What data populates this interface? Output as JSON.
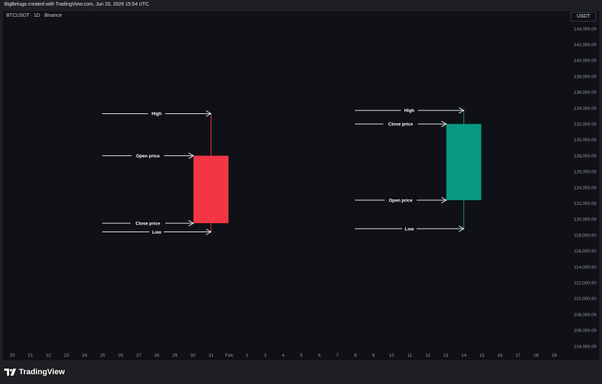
{
  "header": {
    "attribution": "BigBeluga created with TradingView.com, Jun 20, 2026 15:54 UTC"
  },
  "chart": {
    "symbol": "BTCUSDT · 1D · Binance",
    "currency": "USDT"
  },
  "footer": {
    "brand": "TradingView"
  },
  "colors": {
    "bearish": "#f23645",
    "bullish": "#089981",
    "background": "#0f1116",
    "axis_text": "#9598a1",
    "annotation": "#e8eaed"
  },
  "chart_data": {
    "type": "candlestick",
    "y_axis": {
      "range": [
        103000,
        145000
      ],
      "ticks": [
        "104,000.00",
        "106,000.00",
        "108,000.00",
        "110,000.00",
        "112,000.00",
        "114,000.00",
        "116,000.00",
        "118,000.00",
        "120,000.00",
        "122,000.00",
        "124,000.00",
        "126,000.00",
        "128,000.00",
        "130,000.00",
        "132,000.00",
        "134,000.00",
        "136,000.00",
        "138,000.00",
        "140,000.00",
        "142,000.00",
        "144,000.00"
      ]
    },
    "x_axis": {
      "ticks": [
        "20",
        "21",
        "22",
        "23",
        "24",
        "25",
        "26",
        "27",
        "28",
        "29",
        "30",
        "31",
        "Feb",
        "2",
        "3",
        "4",
        "5",
        "6",
        "7",
        "8",
        "9",
        "10",
        "11",
        "12",
        "13",
        "14",
        "15",
        "16",
        "17",
        "18",
        "19"
      ]
    },
    "candles": [
      {
        "date": "31",
        "open": 128000,
        "high": 133300,
        "low": 118400,
        "close": 119500
      },
      {
        "date": "14",
        "open": 122400,
        "high": 133700,
        "low": 118800,
        "close": 132000
      }
    ],
    "annotations": [
      {
        "candle": 0,
        "label": "High",
        "field": "high"
      },
      {
        "candle": 0,
        "label": "Open price",
        "field": "open"
      },
      {
        "candle": 0,
        "label": "Close price",
        "field": "close"
      },
      {
        "candle": 0,
        "label": "Low",
        "field": "low"
      },
      {
        "candle": 1,
        "label": "High",
        "field": "high"
      },
      {
        "candle": 1,
        "label": "Close price",
        "field": "close"
      },
      {
        "candle": 1,
        "label": "Open price",
        "field": "open"
      },
      {
        "candle": 1,
        "label": "Low",
        "field": "low"
      }
    ]
  }
}
